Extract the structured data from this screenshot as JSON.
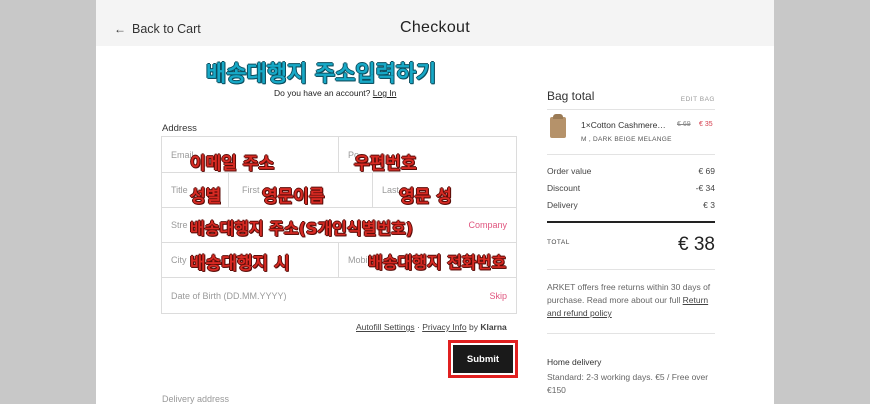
{
  "header": {
    "back_label": "Back to Cart",
    "back_icon": "arrow-left-icon",
    "title": "Checkout"
  },
  "overlays": {
    "main_heading": "배송대행지 주소입력하기",
    "email_note": "이메일 주소",
    "postal_note": "우편번호",
    "title_note": "성별",
    "first_name_note": "영문이름",
    "last_name_note": "영문 성",
    "street_note": "배송대행지 주소(S개인식별번호)",
    "city_note": "배송대행지 시",
    "mobile_note": "배송대행지 전화번호",
    "heading_color": "#17a9c7",
    "note_color": "#d72a23"
  },
  "account": {
    "question": "Do you have an account?",
    "login_label": "Log In"
  },
  "form": {
    "section_label": "Address",
    "email_placeholder": "Email",
    "postal_placeholder": "Po",
    "title_placeholder": "Title",
    "first_name_placeholder": "First",
    "last_name_placeholder": "Last",
    "street_placeholder": "Stre",
    "company_link": "Company",
    "city_placeholder": "City",
    "mobile_placeholder": "Mobi",
    "dob_placeholder": "Date of Birth (DD.MM.YYYY)",
    "skip_link": "Skip",
    "accent_color": "#e0567f"
  },
  "autofill": {
    "settings_label": "Autofill Settings",
    "separator": "·",
    "privacy_label": "Privacy Info",
    "by_label": "by",
    "brand": "Klarna"
  },
  "submit_label": "Submit",
  "delivery_label": "Delivery address",
  "summary": {
    "title": "Bag total",
    "edit_label": "EDIT BAG",
    "item": {
      "name": "1×Cotton Cashmere…",
      "old_price": "€ 69",
      "new_price": "€ 35",
      "variant": "M , DARK BEIGE MELANGE"
    },
    "rows": [
      {
        "label": "Order value",
        "value": "€ 69"
      },
      {
        "label": "Discount",
        "value": "-€ 34"
      },
      {
        "label": "Delivery",
        "value": "€ 3"
      }
    ],
    "total_label": "TOTAL",
    "total_value": "€ 38",
    "returns_text": "ARKET offers free returns within 30 days of purchase. Read more about our full",
    "returns_link": "Return and refund policy",
    "home_delivery_title": "Home delivery",
    "home_delivery_desc": "Standard: 2-3 working days. €5 / Free over €150"
  }
}
